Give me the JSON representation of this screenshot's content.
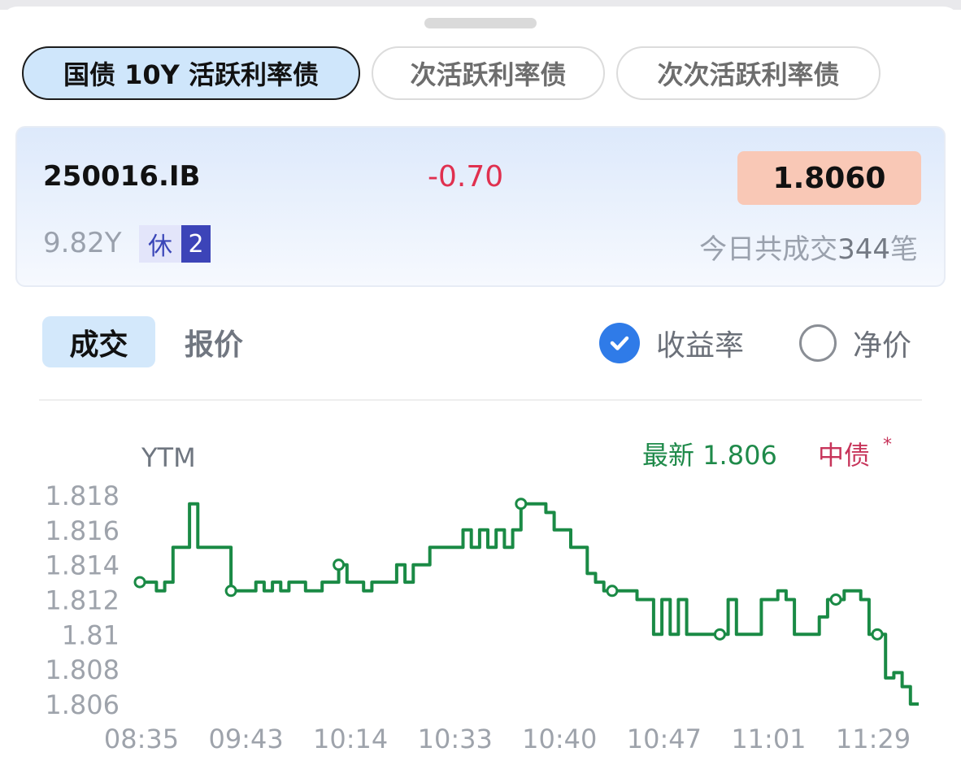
{
  "tabs": [
    {
      "label": "国债 10Y 活跃利率债",
      "active": true
    },
    {
      "label": "次活跃利率债",
      "active": false
    },
    {
      "label": "次次活跃利率债",
      "active": false
    }
  ],
  "bond": {
    "code": "250016.IB",
    "change": "-0.70",
    "price": "1.8060",
    "tenor": "9.82Y",
    "badge": "休",
    "badge_count": "2",
    "deals_prefix": "今日共成交",
    "deals_count": "344",
    "deals_suffix": "笔"
  },
  "view_tabs": {
    "trades": "成交",
    "quotes": "报价"
  },
  "options": {
    "yield": "收益率",
    "clean_price": "净价",
    "selected": "yield"
  },
  "chart_header": {
    "latest_label": "最新",
    "latest_value": "1.806",
    "source": "中债",
    "source_mark": "*"
  },
  "colors": {
    "line": "#1a8a45",
    "accent_blue": "#2f7be8",
    "down_red": "#e0304f",
    "price_box": "#f9c8b6"
  },
  "chart_data": {
    "type": "line",
    "ylabel": "YTM",
    "ylim": [
      1.806,
      1.818
    ],
    "yticks": [
      "1.818",
      "1.816",
      "1.814",
      "1.812",
      "1.81",
      "1.808",
      "1.806"
    ],
    "xticks": [
      "08:35",
      "09:43",
      "10:14",
      "10:33",
      "10:40",
      "10:47",
      "11:01",
      "11:29"
    ],
    "series": [
      {
        "values": [
          1.813,
          1.813,
          1.8125,
          1.813,
          1.815,
          1.815,
          1.8175,
          1.815,
          1.815,
          1.815,
          1.815,
          1.8125,
          1.8125,
          1.8125,
          1.813,
          1.8125,
          1.813,
          1.8125,
          1.813,
          1.813,
          1.8125,
          1.8125,
          1.813,
          1.813,
          1.814,
          1.813,
          1.813,
          1.8125,
          1.813,
          1.813,
          1.813,
          1.814,
          1.813,
          1.814,
          1.814,
          1.815,
          1.815,
          1.815,
          1.815,
          1.816,
          1.815,
          1.816,
          1.815,
          1.816,
          1.815,
          1.816,
          1.8175,
          1.8175,
          1.8175,
          1.817,
          1.816,
          1.816,
          1.815,
          1.815,
          1.8135,
          1.813,
          1.8125,
          1.8125,
          1.8125,
          1.8125,
          1.812,
          1.812,
          1.81,
          1.812,
          1.81,
          1.812,
          1.81,
          1.81,
          1.81,
          1.81,
          1.81,
          1.812,
          1.81,
          1.81,
          1.81,
          1.812,
          1.812,
          1.8125,
          1.812,
          1.81,
          1.81,
          1.81,
          1.811,
          1.812,
          1.812,
          1.8125,
          1.8125,
          1.812,
          1.81,
          1.81,
          1.8075,
          1.8078,
          1.807,
          1.806,
          1.806
        ]
      }
    ],
    "markers_at": [
      0,
      11,
      24,
      46,
      57,
      70,
      84,
      89
    ],
    "grid": false
  }
}
